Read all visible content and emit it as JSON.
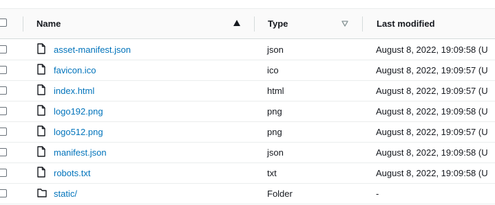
{
  "header": {
    "name_label": "Name",
    "type_label": "Type",
    "modified_label": "Last modified"
  },
  "rows": [
    {
      "name": "asset-manifest.json",
      "type": "json",
      "modified": "August 8, 2022, 19:09:58 (U",
      "icon": "file-icon"
    },
    {
      "name": "favicon.ico",
      "type": "ico",
      "modified": "August 8, 2022, 19:09:57 (U",
      "icon": "file-icon"
    },
    {
      "name": "index.html",
      "type": "html",
      "modified": "August 8, 2022, 19:09:57 (U",
      "icon": "file-icon"
    },
    {
      "name": "logo192.png",
      "type": "png",
      "modified": "August 8, 2022, 19:09:58 (U",
      "icon": "file-icon"
    },
    {
      "name": "logo512.png",
      "type": "png",
      "modified": "August 8, 2022, 19:09:57 (U",
      "icon": "file-icon"
    },
    {
      "name": "manifest.json",
      "type": "json",
      "modified": "August 8, 2022, 19:09:58 (U",
      "icon": "file-icon"
    },
    {
      "name": "robots.txt",
      "type": "txt",
      "modified": "August 8, 2022, 19:09:58 (U",
      "icon": "file-icon"
    },
    {
      "name": "static/",
      "type": "Folder",
      "modified": "-",
      "icon": "folder-icon"
    }
  ],
  "colors": {
    "link": "#0073bb",
    "text": "#16191f",
    "header_bg": "#fafafa",
    "border": "#eaeded"
  }
}
